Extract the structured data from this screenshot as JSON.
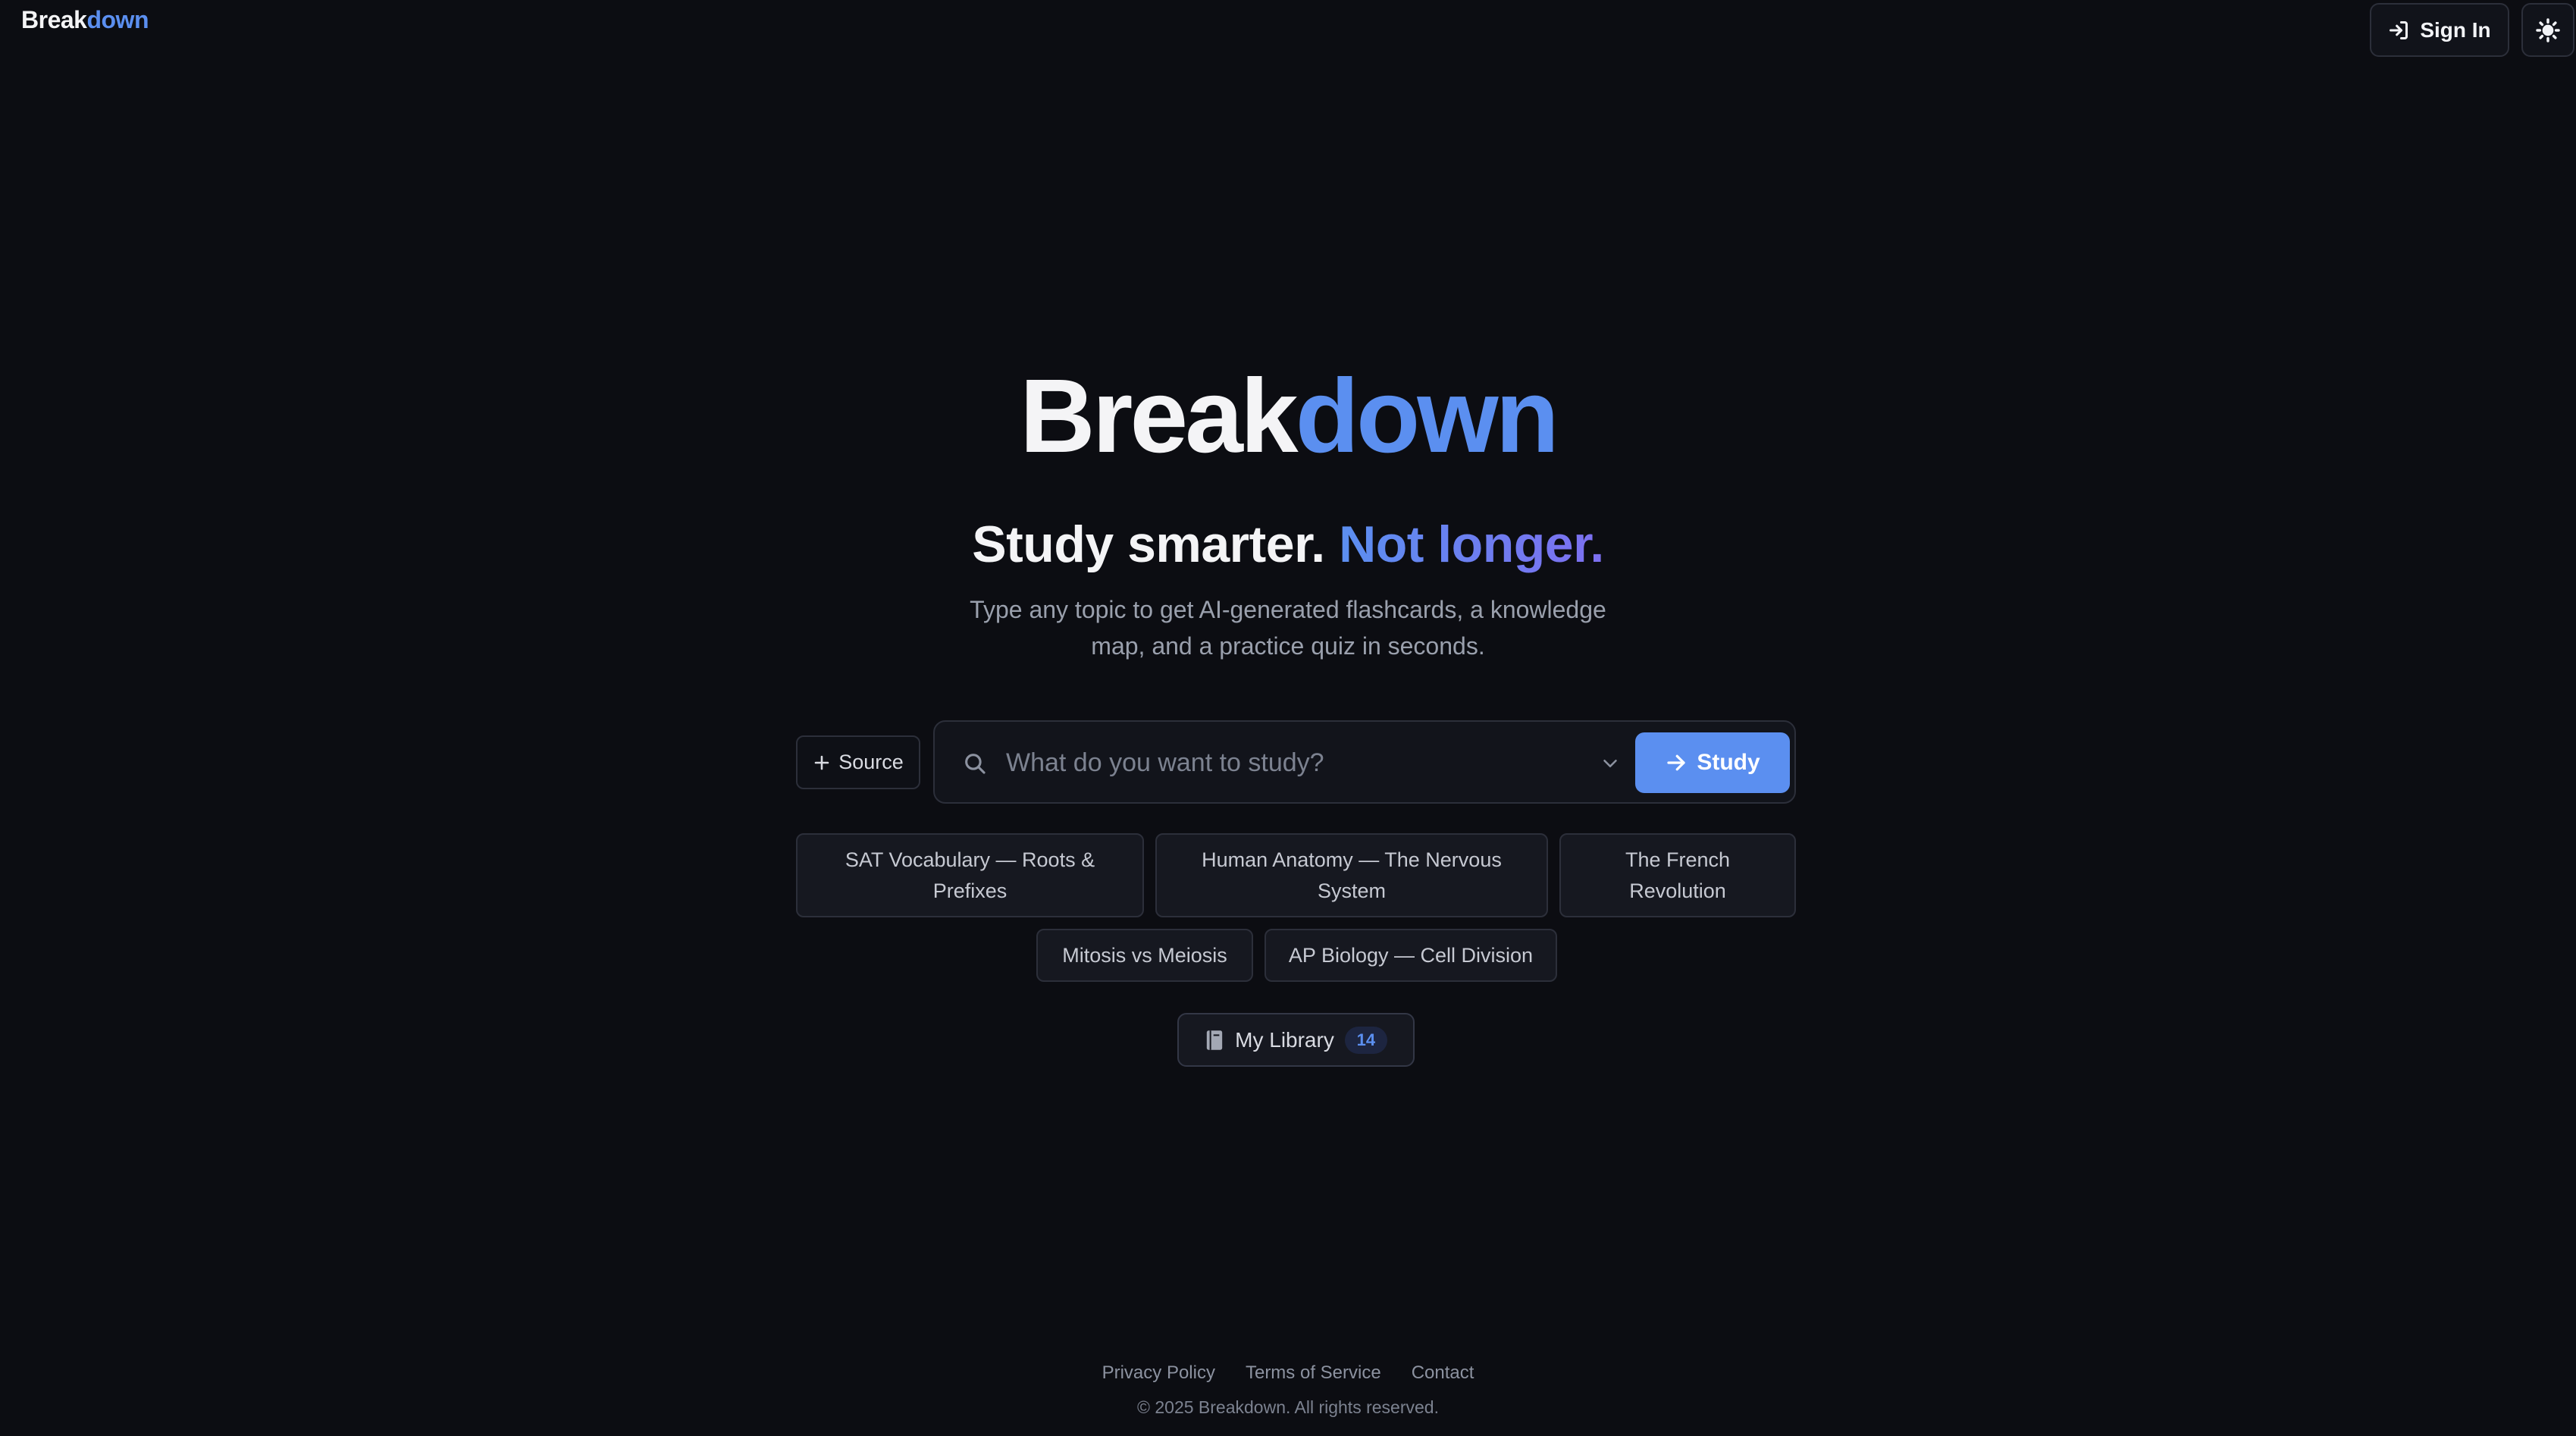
{
  "header": {
    "brand_part1": "Break",
    "brand_part2": "down",
    "sign_in_label": "Sign In"
  },
  "hero": {
    "title_part1": "Break",
    "title_part2": "down",
    "tagline_part1": "Study smarter.",
    "tagline_part2": "Not longer.",
    "subtitle": "Type any topic to get AI-generated flashcards, a knowledge map, and a practice quiz in seconds."
  },
  "search": {
    "source_label": "Source",
    "placeholder": "What do you want to study?",
    "value": "",
    "study_label": "Study"
  },
  "suggestions": [
    "SAT Vocabulary — Roots & Prefixes",
    "Human Anatomy — The Nervous System",
    "The French Revolution",
    "Mitosis vs Meiosis",
    "AP Biology — Cell Division"
  ],
  "library": {
    "label": "My Library",
    "count": "14"
  },
  "footer": {
    "privacy": "Privacy Policy",
    "terms": "Terms of Service",
    "contact": "Contact",
    "copyright": "© 2025 Breakdown. All rights reserved."
  },
  "colors": {
    "background": "#0c0d12",
    "accent": "#5b8ff0",
    "accent_secondary": "#7d6ff0",
    "border": "#2c2f3a"
  },
  "icons": {
    "sign_in": "login-icon",
    "theme": "sun-icon",
    "source": "plus-icon",
    "search": "search-icon",
    "dropdown": "chevron-down-icon",
    "study": "arrow-right-icon",
    "library": "book-icon"
  }
}
